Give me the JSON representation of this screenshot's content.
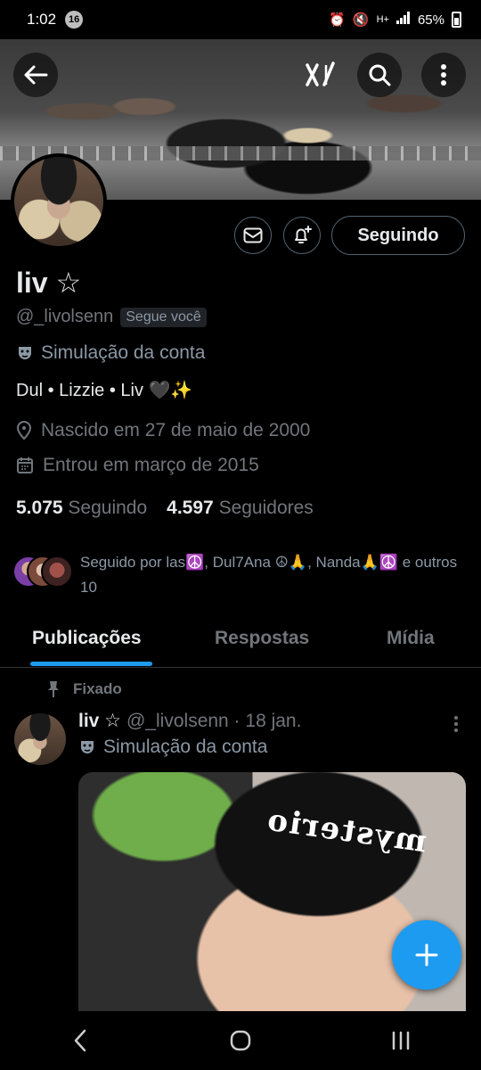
{
  "status_bar": {
    "time": "1:02",
    "notification_count": "16",
    "battery": "65%",
    "network": "H+"
  },
  "profile": {
    "name": "liv ☆",
    "handle": "@_livolsenn",
    "follows_you": "Segue você",
    "account_type": "Simulação da conta",
    "bio": "Dul • Lizzie • Liv 🖤✨",
    "born": "Nascido em 27 de maio de 2000",
    "joined": "Entrou em março de 2015",
    "following_count": "5.075",
    "following_label": "Seguindo",
    "followers_count": "4.597",
    "followers_label": "Seguidores",
    "followed_by": "Seguido por las☮️, Dul7Ana ☮🙏, Nanda🙏☮️ e outros 10",
    "follow_button": "Seguindo"
  },
  "tabs": [
    {
      "label": "Publicações",
      "active": true
    },
    {
      "label": "Respostas",
      "active": false
    },
    {
      "label": "Mídia",
      "active": false
    }
  ],
  "post": {
    "pinned_label": "Fixado",
    "author_name": "liv ☆",
    "author_meta": "@_livolsenn · 18 jan.",
    "account_type": "Simulação da conta",
    "media_text": "mysterio"
  },
  "colors": {
    "accent": "#1d9bf0",
    "background": "#000000",
    "text_primary": "#e7e9ea",
    "text_secondary": "#71767b",
    "border": "#536471"
  },
  "icons": [
    "back-arrow-icon",
    "grok-logo-icon",
    "search-icon",
    "more-vertical-icon",
    "mail-icon",
    "bell-plus-icon",
    "mask-icon",
    "location-pin-icon",
    "calendar-icon",
    "pin-icon",
    "plus-icon",
    "nav-back-icon",
    "nav-home-icon",
    "nav-recents-icon"
  ]
}
